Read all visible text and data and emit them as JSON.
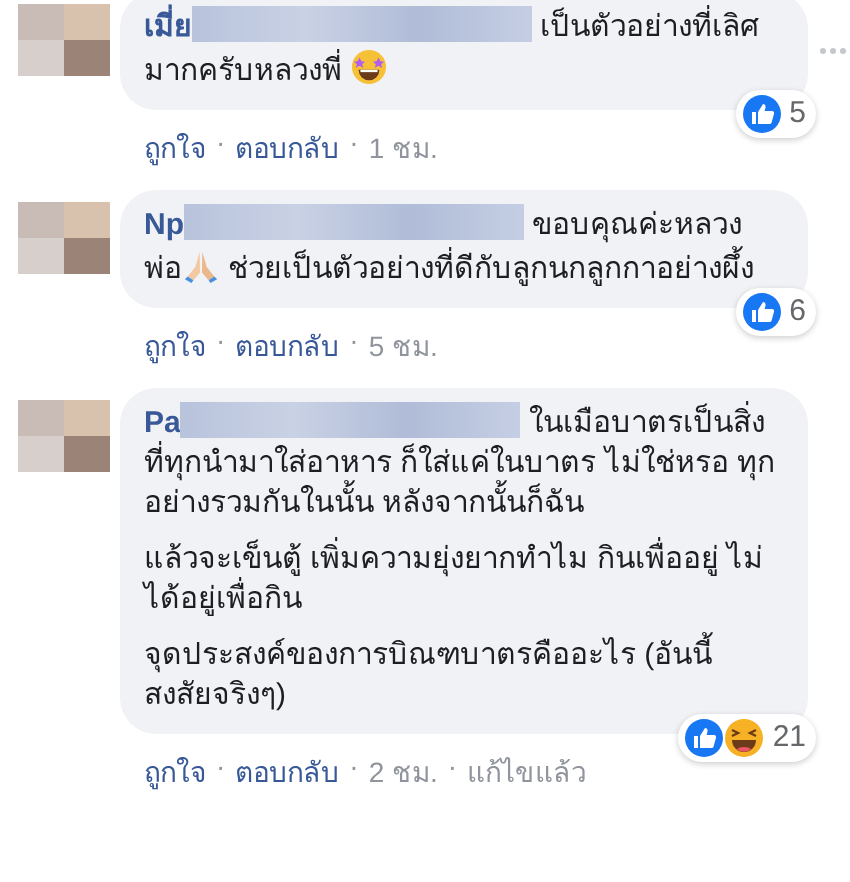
{
  "comments": [
    {
      "name": "เมี่ย",
      "redacted": true,
      "options_shown": true,
      "paragraphs": [
        [
          {
            "kind": "text",
            "text": "เป็นตัวอย่างที่เลิศมากครับหลวงพี่ "
          },
          {
            "kind": "star-grin"
          }
        ]
      ],
      "reactions": [
        {
          "kind": "like"
        }
      ],
      "reaction_count": "5",
      "actions": [
        {
          "kind": "link",
          "text": "ถูกใจ"
        },
        {
          "kind": "link",
          "text": "ตอบกลับ"
        },
        {
          "kind": "meta",
          "text": "1 ชม."
        }
      ]
    },
    {
      "name": "Np",
      "redacted": true,
      "options_shown": false,
      "paragraphs": [
        [
          {
            "kind": "text",
            "text": "ขอบคุณค่ะหลวงพ่อ"
          },
          {
            "kind": "pray"
          },
          {
            "kind": "text",
            "text": " ช่วยเป็นตัวอย่างที่ดีกับลูกนกลูกกาอย่างผึ้ง"
          }
        ]
      ],
      "reactions": [
        {
          "kind": "like"
        }
      ],
      "reaction_count": "6",
      "actions": [
        {
          "kind": "link",
          "text": "ถูกใจ"
        },
        {
          "kind": "link",
          "text": "ตอบกลับ"
        },
        {
          "kind": "meta",
          "text": "5 ชม."
        }
      ]
    },
    {
      "name": "Pa",
      "redacted": true,
      "options_shown": false,
      "paragraphs": [
        [
          {
            "kind": "text",
            "text": "ในเมือบาตรเป็นสิ่งที่ทุกนำมาใส่อาหาร ก็ใส่แค่ในบาตร ไม่ใช่หรอ ทุกอย่างรวมกันในนั้น หลังจากนั้นก็ฉัน"
          }
        ],
        [
          {
            "kind": "text",
            "text": "แล้วจะเข็นตู้ เพิ่มความยุ่งยากทำไม กินเพื่ออยู่ ไม่ได้อยู่เพื่อกิน"
          }
        ],
        [
          {
            "kind": "text",
            "text": "จุดประสงค์ของการบิณฑบาตรคืออะไร (อันนี้สงสัยจริงๆ)"
          }
        ]
      ],
      "reactions": [
        {
          "kind": "like"
        },
        {
          "kind": "haha"
        }
      ],
      "reaction_count": "21",
      "actions": [
        {
          "kind": "link",
          "text": "ถูกใจ"
        },
        {
          "kind": "link",
          "text": "ตอบกลับ"
        },
        {
          "kind": "meta",
          "text": "2 ชม."
        },
        {
          "kind": "meta",
          "text": "แก้ไขแล้ว"
        }
      ]
    }
  ],
  "separator": "·"
}
